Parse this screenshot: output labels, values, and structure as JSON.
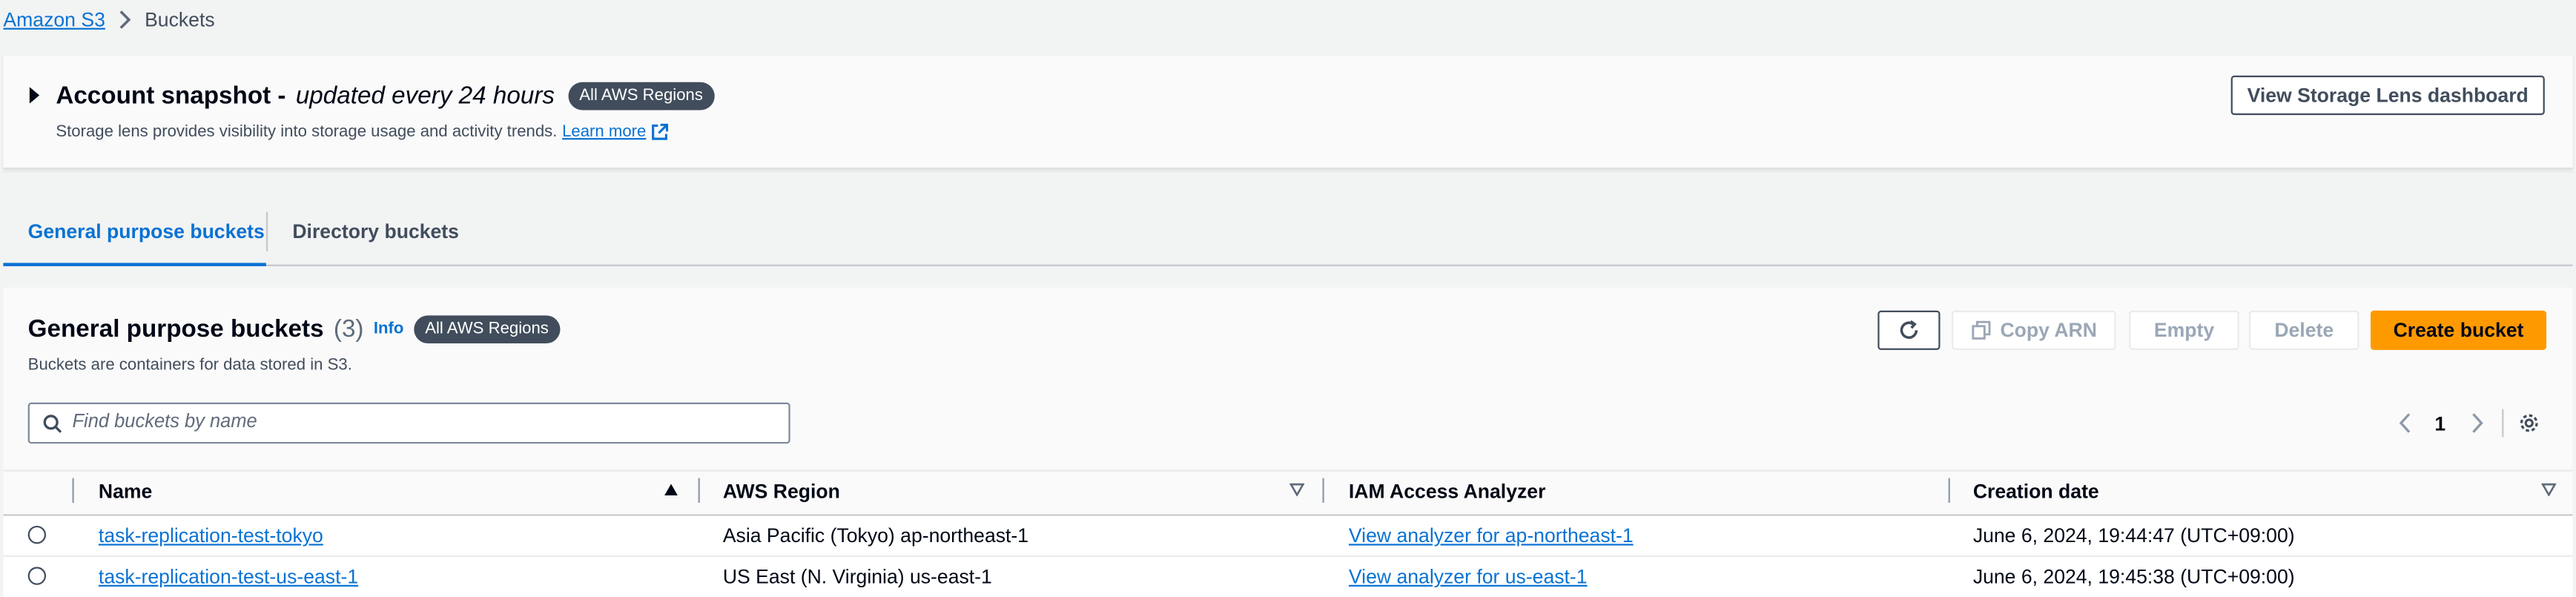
{
  "breadcrumb": {
    "root": "Amazon S3",
    "current": "Buckets"
  },
  "snapshot": {
    "title": "Account snapshot - ",
    "title_italic": "updated every 24 hours",
    "region_badge": "All AWS Regions",
    "description": "Storage lens provides visibility into storage usage and activity trends.",
    "learn_more": "Learn more",
    "view_button": "View Storage Lens dashboard"
  },
  "tabs": [
    {
      "label": "General purpose buckets",
      "active": true
    },
    {
      "label": "Directory buckets",
      "active": false
    }
  ],
  "buckets_panel": {
    "title": "General purpose buckets",
    "count": "(3)",
    "info": "Info",
    "region_badge": "All AWS Regions",
    "description": "Buckets are containers for data stored in S3.",
    "actions": {
      "copy_arn": "Copy ARN",
      "empty": "Empty",
      "delete": "Delete",
      "create": "Create bucket"
    },
    "search_placeholder": "Find buckets by name",
    "page_number": "1",
    "columns": [
      "Name",
      "AWS Region",
      "IAM Access Analyzer",
      "Creation date"
    ],
    "rows": [
      {
        "name": "task-replication-test-tokyo",
        "region": "Asia Pacific (Tokyo) ap-northeast-1",
        "analyzer": "View analyzer for ap-northeast-1",
        "created": "June 6, 2024, 19:44:47 (UTC+09:00)"
      },
      {
        "name": "task-replication-test-us-east-1",
        "region": "US East (N. Virginia) us-east-1",
        "analyzer": "View analyzer for us-east-1",
        "created": "June 6, 2024, 19:45:38 (UTC+09:00)"
      }
    ]
  },
  "colors": {
    "link": "#0972d3",
    "primary": "#ff9900",
    "badge": "#414d5c"
  }
}
